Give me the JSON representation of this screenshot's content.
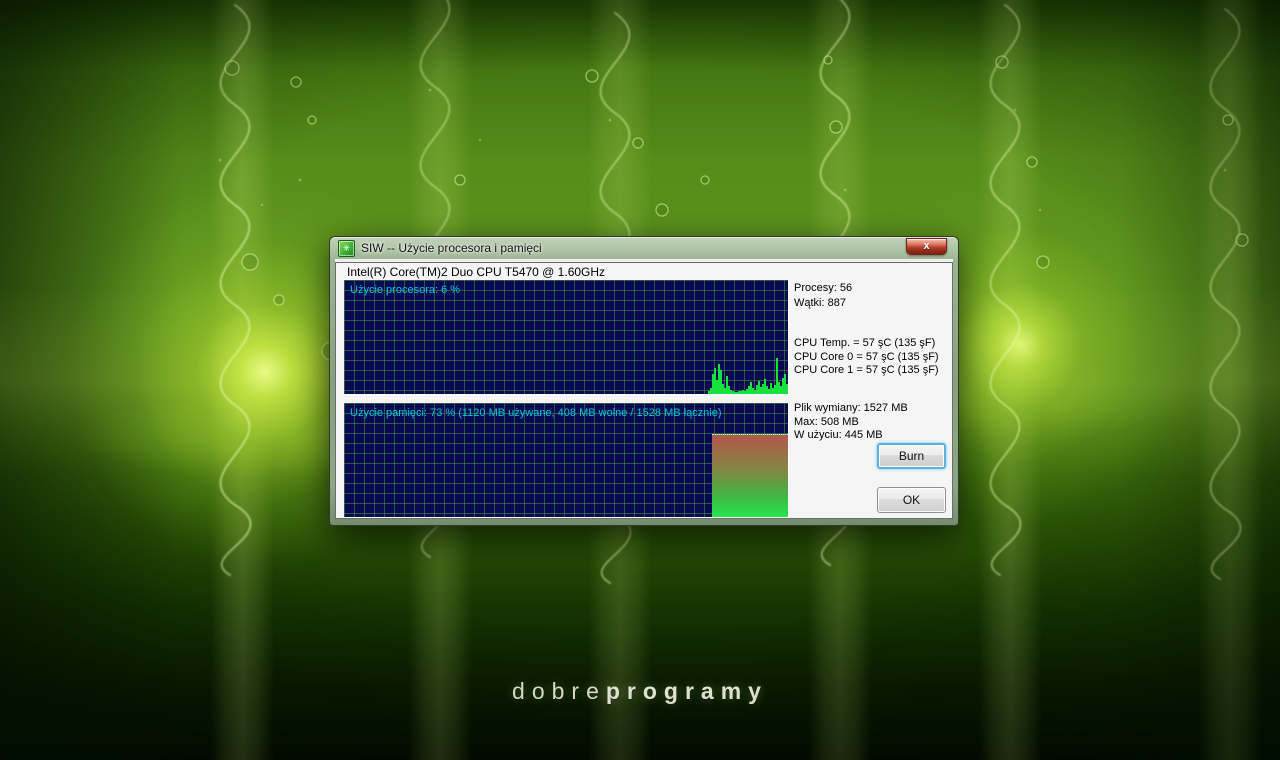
{
  "window": {
    "title": "SIW -- Użycie procesora i pamięci",
    "close_label": "x"
  },
  "cpu": {
    "name": "Intel(R) Core(TM)2 Duo CPU T5470 @ 1.60GHz",
    "usage_label": "Użycie procesora: 6 %",
    "usage_percent": 6,
    "stats": {
      "processes": "Procesy: 56",
      "threads": "Wątki: 887",
      "temp": "CPU Temp. = 57 şC (135 şF)",
      "core0": "CPU Core 0 = 57 şC (135 şF)",
      "core1": "CPU Core 1 = 57 şC (135 şF)"
    },
    "history_bars": [
      3,
      6,
      20,
      26,
      14,
      30,
      24,
      10,
      6,
      18,
      8,
      4,
      3,
      2,
      2,
      3,
      3,
      4,
      3,
      5,
      8,
      12,
      6,
      4,
      9,
      13,
      7,
      10,
      15,
      8,
      5,
      11,
      6,
      9,
      36,
      12,
      8,
      16,
      20,
      10
    ]
  },
  "memory": {
    "usage_label": "Użycie pamięci: 73 % (1120 MB używane, 408 MB wolne / 1528 MB łącznie)",
    "usage_percent": 73,
    "stats": {
      "pagefile": "Plik wymiany: 1527 MB",
      "max": "Max: 508 MB",
      "in_use": "W użyciu: 445 MB"
    }
  },
  "buttons": {
    "burn": "Burn",
    "ok": "OK"
  },
  "wallpaper": {
    "brand_light": "dobre",
    "brand_bold": "programy"
  },
  "colors": {
    "graph_background": "#0a0a52",
    "graph_grid": "#48943a",
    "graph_label": "#00c8dc",
    "cpu_spike_green": "#17e23d",
    "memory_gradient_top": "#b4584e",
    "memory_gradient_bottom": "#25e44d",
    "close_button_red": "#b13f2b",
    "burn_focus_blue": "#58b2de",
    "wallpaper_glow": "#d2f046"
  }
}
